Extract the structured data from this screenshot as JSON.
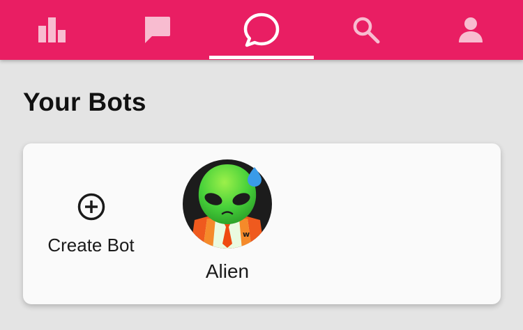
{
  "nav": {
    "tabs": [
      {
        "id": "stats",
        "icon": "bar-chart-icon",
        "active": false
      },
      {
        "id": "messages",
        "icon": "chat-bubble-icon",
        "active": false
      },
      {
        "id": "bots",
        "icon": "chat-circle-icon",
        "active": true
      },
      {
        "id": "search",
        "icon": "search-icon",
        "active": false
      },
      {
        "id": "profile",
        "icon": "person-icon",
        "active": false
      }
    ]
  },
  "colors": {
    "topbar": "#e91e63",
    "background": "#e4e4e4",
    "card": "#fafafa"
  },
  "page": {
    "title": "Your Bots"
  },
  "bots_card": {
    "create_label": "Create Bot",
    "create_icon": "plus-circle-icon",
    "bots": [
      {
        "name": "Alien",
        "avatar": "alien-avatar"
      }
    ]
  }
}
